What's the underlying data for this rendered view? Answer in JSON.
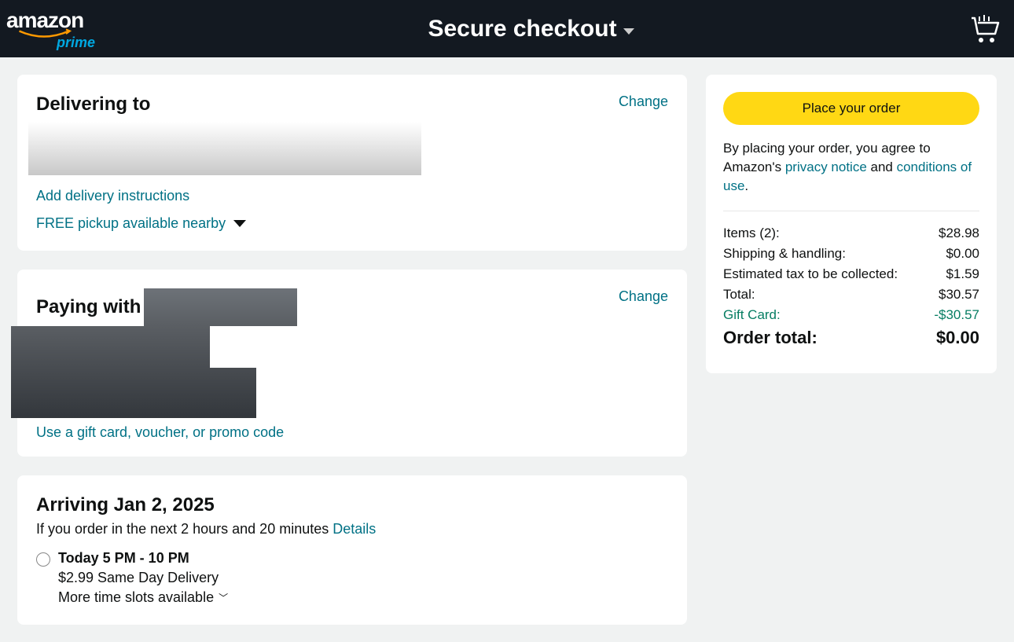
{
  "header": {
    "logo_top": "amazon",
    "logo_sub": "prime",
    "title": "Secure checkout"
  },
  "delivery": {
    "title": "Delivering to",
    "change": "Change",
    "add_instructions": "Add delivery instructions",
    "free_pickup": "FREE pickup available nearby"
  },
  "payment": {
    "title": "Paying with",
    "change": "Change",
    "gift_card_link": "Use a gift card, voucher, or promo code"
  },
  "arriving": {
    "title": "Arriving Jan 2, 2025",
    "sub": "If you order in the next 2 hours and 20 minutes ",
    "details": "Details",
    "option_title": "Today 5 PM - 10 PM",
    "option_price": "$2.99 Same Day Delivery",
    "more_slots": "More time slots available"
  },
  "summary": {
    "place_order": "Place your order",
    "terms_prefix": "By placing your order, you agree to Amazon's ",
    "privacy": "privacy notice",
    "and": " and ",
    "conditions": "conditions of use",
    "period": ".",
    "rows": {
      "items_label": "Items (2):",
      "items_value": "$28.98",
      "shipping_label": "Shipping & handling:",
      "shipping_value": "$0.00",
      "tax_label": "Estimated tax to be collected:",
      "tax_value": "$1.59",
      "total_label": "Total:",
      "total_value": "$30.57",
      "gift_label": "Gift Card:",
      "gift_value": "-$30.57",
      "order_total_label": "Order total:",
      "order_total_value": "$0.00"
    }
  }
}
